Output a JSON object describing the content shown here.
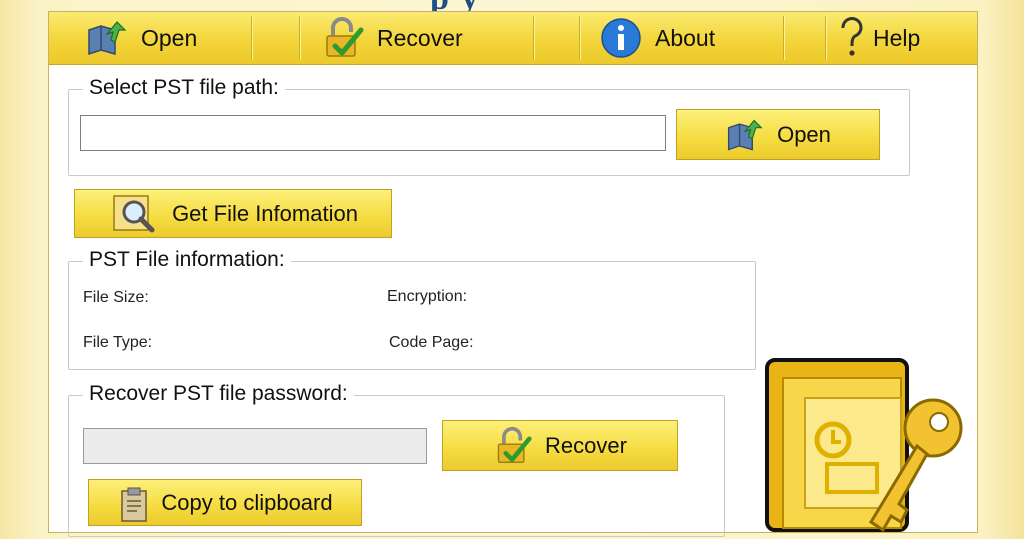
{
  "app_title_fragment": "p                       y",
  "toolbar": {
    "open_label": "Open",
    "recover_label": "Recover",
    "about_label": "About",
    "help_label": "Help"
  },
  "select_group": {
    "title": "Select PST file path:",
    "path_value": "",
    "open_label": "Open"
  },
  "get_info_label": "Get File Infomation",
  "info_group": {
    "title": "PST File information:",
    "file_size_label": "File Size:",
    "encryption_label": "Encryption:",
    "file_type_label": "File Type:",
    "code_page_label": "Code Page:"
  },
  "recover_group": {
    "title": "Recover PST file password:",
    "password_value": "",
    "recover_label": "Recover",
    "copy_label": "Copy to clipboard"
  },
  "colors": {
    "accent_yellow": "#f5db3f",
    "title_blue": "#1e4f86",
    "check_green": "#2e9b2e"
  },
  "icons": [
    "folder-open-icon",
    "padlock-check-icon",
    "info-icon",
    "question-mark-icon",
    "magnifier-document-icon",
    "clipboard-icon",
    "outlook-key-icon"
  ]
}
